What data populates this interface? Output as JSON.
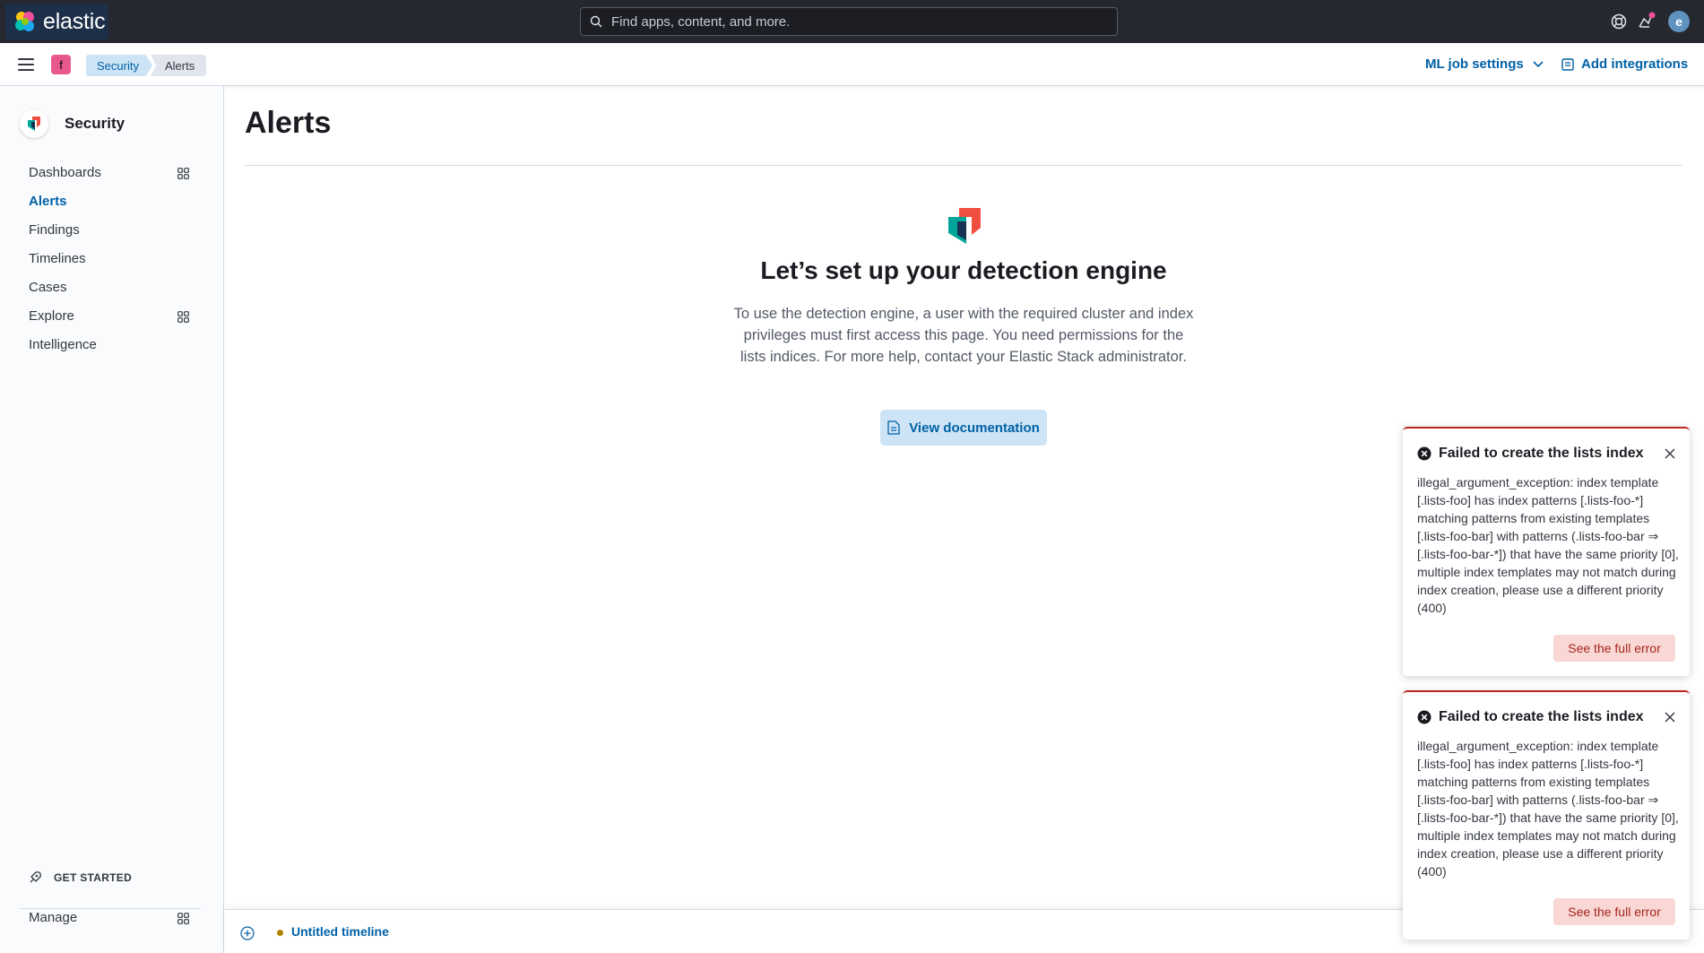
{
  "header": {
    "brand": "elastic",
    "search_placeholder": "Find apps, content, and more.",
    "icons": [
      "help-icon",
      "newsfeed-icon",
      "user-avatar"
    ],
    "avatar_initial": "e"
  },
  "subheader": {
    "space_initial": "f",
    "breadcrumbs": [
      "Security",
      "Alerts"
    ],
    "ml_job_settings": "ML job settings",
    "add_integrations": "Add integrations"
  },
  "sidebar": {
    "title": "Security",
    "items": [
      {
        "label": "Dashboards",
        "has_grid_icon": true,
        "active": false
      },
      {
        "label": "Alerts",
        "has_grid_icon": false,
        "active": true
      },
      {
        "label": "Findings",
        "has_grid_icon": false,
        "active": false
      },
      {
        "label": "Timelines",
        "has_grid_icon": false,
        "active": false
      },
      {
        "label": "Cases",
        "has_grid_icon": false,
        "active": false
      },
      {
        "label": "Explore",
        "has_grid_icon": true,
        "active": false
      },
      {
        "label": "Intelligence",
        "has_grid_icon": false,
        "active": false
      }
    ],
    "get_started": "GET STARTED",
    "manage": "Manage"
  },
  "main": {
    "title": "Alerts",
    "empty_title": "Let’s set up your detection engine",
    "empty_body": "To use the detection engine, a user with the required cluster and index privileges must first access this page. You need permissions for the lists indices. For more help, contact your Elastic Stack administrator.",
    "doc_button": "View documentation"
  },
  "timeline": {
    "label": "Untitled timeline"
  },
  "toasts": [
    {
      "title": "Failed to create the lists index",
      "body": "illegal_argument_exception: index template [.lists-foo] has index patterns [.lists-foo-*] matching patterns from existing templates [.lists-foo-bar] with patterns (.lists-foo-bar ⇒ [.lists-foo-bar-*]) that have the same priority [0], multiple index templates may not match during index creation, please use a different priority (400)",
      "button": "See the full error"
    },
    {
      "title": "Failed to create the lists index",
      "body": "illegal_argument_exception: index template [.lists-foo] has index patterns [.lists-foo-*] matching patterns from existing templates [.lists-foo-bar] with patterns (.lists-foo-bar ⇒ [.lists-foo-bar-*]) that have the same priority [0], multiple index templates may not match during index creation, please use a different priority (400)",
      "button": "See the full error"
    }
  ],
  "colors": {
    "header_bg": "#25282f",
    "link_blue": "#0061a6",
    "danger": "#bd271e",
    "danger_bg": "#f8d7d4"
  }
}
